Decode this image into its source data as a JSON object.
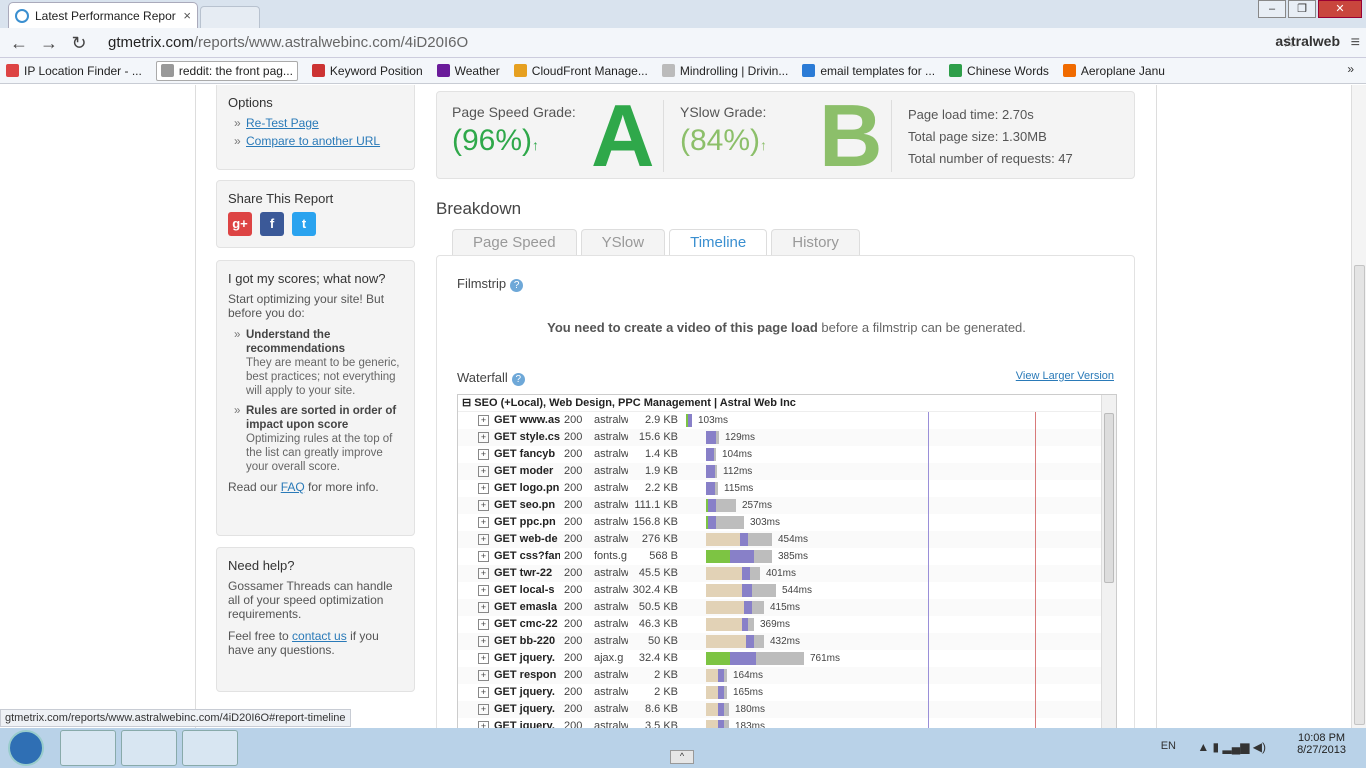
{
  "browser": {
    "tab_title": "Latest Performance Repor",
    "tab_close": "×",
    "url_host": "gtmetrix.com",
    "url_path": "/reports/www.astralwebinc.com/4iD20I6O",
    "brand": "astralweb",
    "win_min": "–",
    "win_max": "❐",
    "win_close": "✕"
  },
  "bookmarks": [
    {
      "label": "IP Location Finder - ...",
      "color": "#d44"
    },
    {
      "label": "reddit: the front pag...",
      "color": "#999"
    },
    {
      "label": "Keyword Position",
      "color": "#c33"
    },
    {
      "label": "Weather",
      "color": "#6a1b9a"
    },
    {
      "label": "CloudFront Manage...",
      "color": "#e6a020"
    },
    {
      "label": "Mindrolling | Drivin...",
      "color": "#bbb"
    },
    {
      "label": "email templates for ...",
      "color": "#2b7bd6"
    },
    {
      "label": "Chinese Words",
      "color": "#2e9e4a"
    },
    {
      "label": "Aeroplane Janu",
      "color": "#f06a00"
    }
  ],
  "bookmarks_more": "»",
  "sidebar": {
    "options_title": "Options",
    "retest": "Re-Test Page",
    "compare": "Compare to another URL",
    "share_title": "Share This Report",
    "share_icons": [
      "g+",
      "f",
      "t"
    ],
    "scores_title": "I got my scores; what now?",
    "scores_intro": "Start optimizing your site! But before you do:",
    "tip1_title": "Understand the recommendations",
    "tip1_body": "They are meant to be generic, best practices; not everything will apply to your site.",
    "tip2_title": "Rules are sorted in order of impact upon score",
    "tip2_body": "Optimizing rules at the top of the list can greatly improve your overall score.",
    "read_pre": "Read our ",
    "read_link": "FAQ",
    "read_post": " for more info.",
    "help_title": "Need help?",
    "help_body": "Gossamer Threads can handle all of your speed optimization requirements.",
    "help_pre": "Feel free to ",
    "help_link": "contact us",
    "help_post": " if you have any questions."
  },
  "grades": {
    "ps_label": "Page Speed Grade:",
    "ps_pct": "(96%)",
    "ps_letter": "A",
    "ps_arrow": "↑",
    "ys_label": "YSlow Grade:",
    "ys_pct": "(84%)",
    "ys_letter": "B",
    "ys_arrow": "↑",
    "load_time": "Page load time: 2.70s",
    "page_size": "Total page size: 1.30MB",
    "requests": "Total number of requests: 47",
    "color_a": "#2fa84a",
    "color_b": "#8cbf6a"
  },
  "breakdown": {
    "title": "Breakdown",
    "tabs": [
      "Page Speed",
      "YSlow",
      "Timeline",
      "History"
    ],
    "active_tab": "Timeline",
    "filmstrip_label": "Filmstrip",
    "film_bold": "You need to create a video of this page load",
    "film_rest": " before a filmstrip can be generated.",
    "waterfall_label": "Waterfall",
    "view_larger": "View Larger Version"
  },
  "waterfall": {
    "header": "SEO (+Local), Web Design, PPC Management | Astral Web Inc",
    "collapse": "⊟",
    "expand": "+",
    "rows": [
      {
        "name": "GET www.as",
        "status": "200",
        "domain": "astralw",
        "size": "2.9 KB",
        "time": "103ms",
        "start": 0,
        "blocks": [
          [
            0,
            0,
            0,
            0
          ],
          [
            0,
            2,
            4,
            0
          ]
        ]
      },
      {
        "name": "GET style.cs",
        "status": "200",
        "domain": "astralw",
        "size": "15.6 KB",
        "time": "129ms",
        "start": 20,
        "blocks": [
          [
            0,
            0,
            0,
            0
          ],
          [
            0,
            0,
            10,
            3
          ]
        ]
      },
      {
        "name": "GET fancyb",
        "status": "200",
        "domain": "astralw",
        "size": "1.4 KB",
        "time": "104ms",
        "start": 20,
        "blocks": [
          [
            0,
            0,
            0,
            0
          ],
          [
            0,
            0,
            8,
            2
          ]
        ]
      },
      {
        "name": "GET moder",
        "status": "200",
        "domain": "astralw",
        "size": "1.9 KB",
        "time": "112ms",
        "start": 20,
        "blocks": [
          [
            0,
            0,
            0,
            0
          ],
          [
            0,
            0,
            9,
            2
          ]
        ]
      },
      {
        "name": "GET logo.pn",
        "status": "200",
        "domain": "astralw",
        "size": "2.2 KB",
        "time": "115ms",
        "start": 20,
        "blocks": [
          [
            0,
            0,
            0,
            0
          ],
          [
            0,
            0,
            9,
            3
          ]
        ]
      },
      {
        "name": "GET seo.pn",
        "status": "200",
        "domain": "astralw",
        "size": "111.1 KB",
        "time": "257ms",
        "start": 20,
        "blocks": [
          [
            0,
            0,
            0,
            0
          ],
          [
            0,
            2,
            8,
            20
          ]
        ]
      },
      {
        "name": "GET ppc.pn",
        "status": "200",
        "domain": "astralw",
        "size": "156.8 KB",
        "time": "303ms",
        "start": 20,
        "blocks": [
          [
            0,
            0,
            0,
            0
          ],
          [
            0,
            2,
            8,
            28
          ]
        ]
      },
      {
        "name": "GET web-de",
        "status": "200",
        "domain": "astralw",
        "size": "276 KB",
        "time": "454ms",
        "start": 20,
        "blocks": [
          [
            34,
            0,
            0,
            0
          ],
          [
            0,
            0,
            8,
            24
          ]
        ]
      },
      {
        "name": "GET css?fan",
        "status": "200",
        "domain": "fonts.g",
        "size": "568 B",
        "time": "385ms",
        "start": 20,
        "blocks": [
          [
            0,
            0,
            0,
            0
          ],
          [
            0,
            24,
            24,
            18
          ]
        ]
      },
      {
        "name": "GET twr-22",
        "status": "200",
        "domain": "astralw",
        "size": "45.5 KB",
        "time": "401ms",
        "start": 20,
        "blocks": [
          [
            36,
            0,
            0,
            0
          ],
          [
            0,
            0,
            8,
            10
          ]
        ]
      },
      {
        "name": "GET local-s",
        "status": "200",
        "domain": "astralw",
        "size": "302.4 KB",
        "time": "544ms",
        "start": 20,
        "blocks": [
          [
            36,
            0,
            0,
            0
          ],
          [
            0,
            0,
            10,
            24
          ]
        ]
      },
      {
        "name": "GET emasla",
        "status": "200",
        "domain": "astralw",
        "size": "50.5 KB",
        "time": "415ms",
        "start": 20,
        "blocks": [
          [
            38,
            0,
            0,
            0
          ],
          [
            0,
            0,
            8,
            12
          ]
        ]
      },
      {
        "name": "GET cmc-22",
        "status": "200",
        "domain": "astralw",
        "size": "46.3 KB",
        "time": "369ms",
        "start": 20,
        "blocks": [
          [
            36,
            0,
            0,
            0
          ],
          [
            0,
            0,
            6,
            6
          ]
        ]
      },
      {
        "name": "GET bb-220",
        "status": "200",
        "domain": "astralw",
        "size": "50 KB",
        "time": "432ms",
        "start": 20,
        "blocks": [
          [
            40,
            0,
            0,
            0
          ],
          [
            0,
            0,
            8,
            10
          ]
        ]
      },
      {
        "name": "GET jquery.",
        "status": "200",
        "domain": "ajax.g",
        "size": "32.4 KB",
        "time": "761ms",
        "start": 20,
        "blocks": [
          [
            0,
            0,
            0,
            0
          ],
          [
            0,
            24,
            26,
            48
          ]
        ]
      },
      {
        "name": "GET respon",
        "status": "200",
        "domain": "astralw",
        "size": "2 KB",
        "time": "164ms",
        "start": 20,
        "blocks": [
          [
            12,
            0,
            0,
            0
          ],
          [
            0,
            0,
            6,
            3
          ]
        ]
      },
      {
        "name": "GET jquery.",
        "status": "200",
        "domain": "astralw",
        "size": "2 KB",
        "time": "165ms",
        "start": 20,
        "blocks": [
          [
            12,
            0,
            0,
            0
          ],
          [
            0,
            0,
            6,
            3
          ]
        ]
      },
      {
        "name": "GET jquery.",
        "status": "200",
        "domain": "astralw",
        "size": "8.6 KB",
        "time": "180ms",
        "start": 20,
        "blocks": [
          [
            12,
            0,
            0,
            0
          ],
          [
            0,
            0,
            6,
            5
          ]
        ]
      },
      {
        "name": "GET jquery.",
        "status": "200",
        "domain": "astralw",
        "size": "3.5 KB",
        "time": "183ms",
        "start": 20,
        "blocks": [
          [
            12,
            0,
            0,
            0
          ],
          [
            0,
            0,
            6,
            5
          ]
        ]
      }
    ]
  },
  "statusbar": "gtmetrix.com/reports/www.astralwebinc.com/4iD20I6O#report-timeline",
  "taskbar": {
    "lang": "EN",
    "time": "10:08 PM",
    "date": "8/27/2013",
    "show": "^"
  }
}
